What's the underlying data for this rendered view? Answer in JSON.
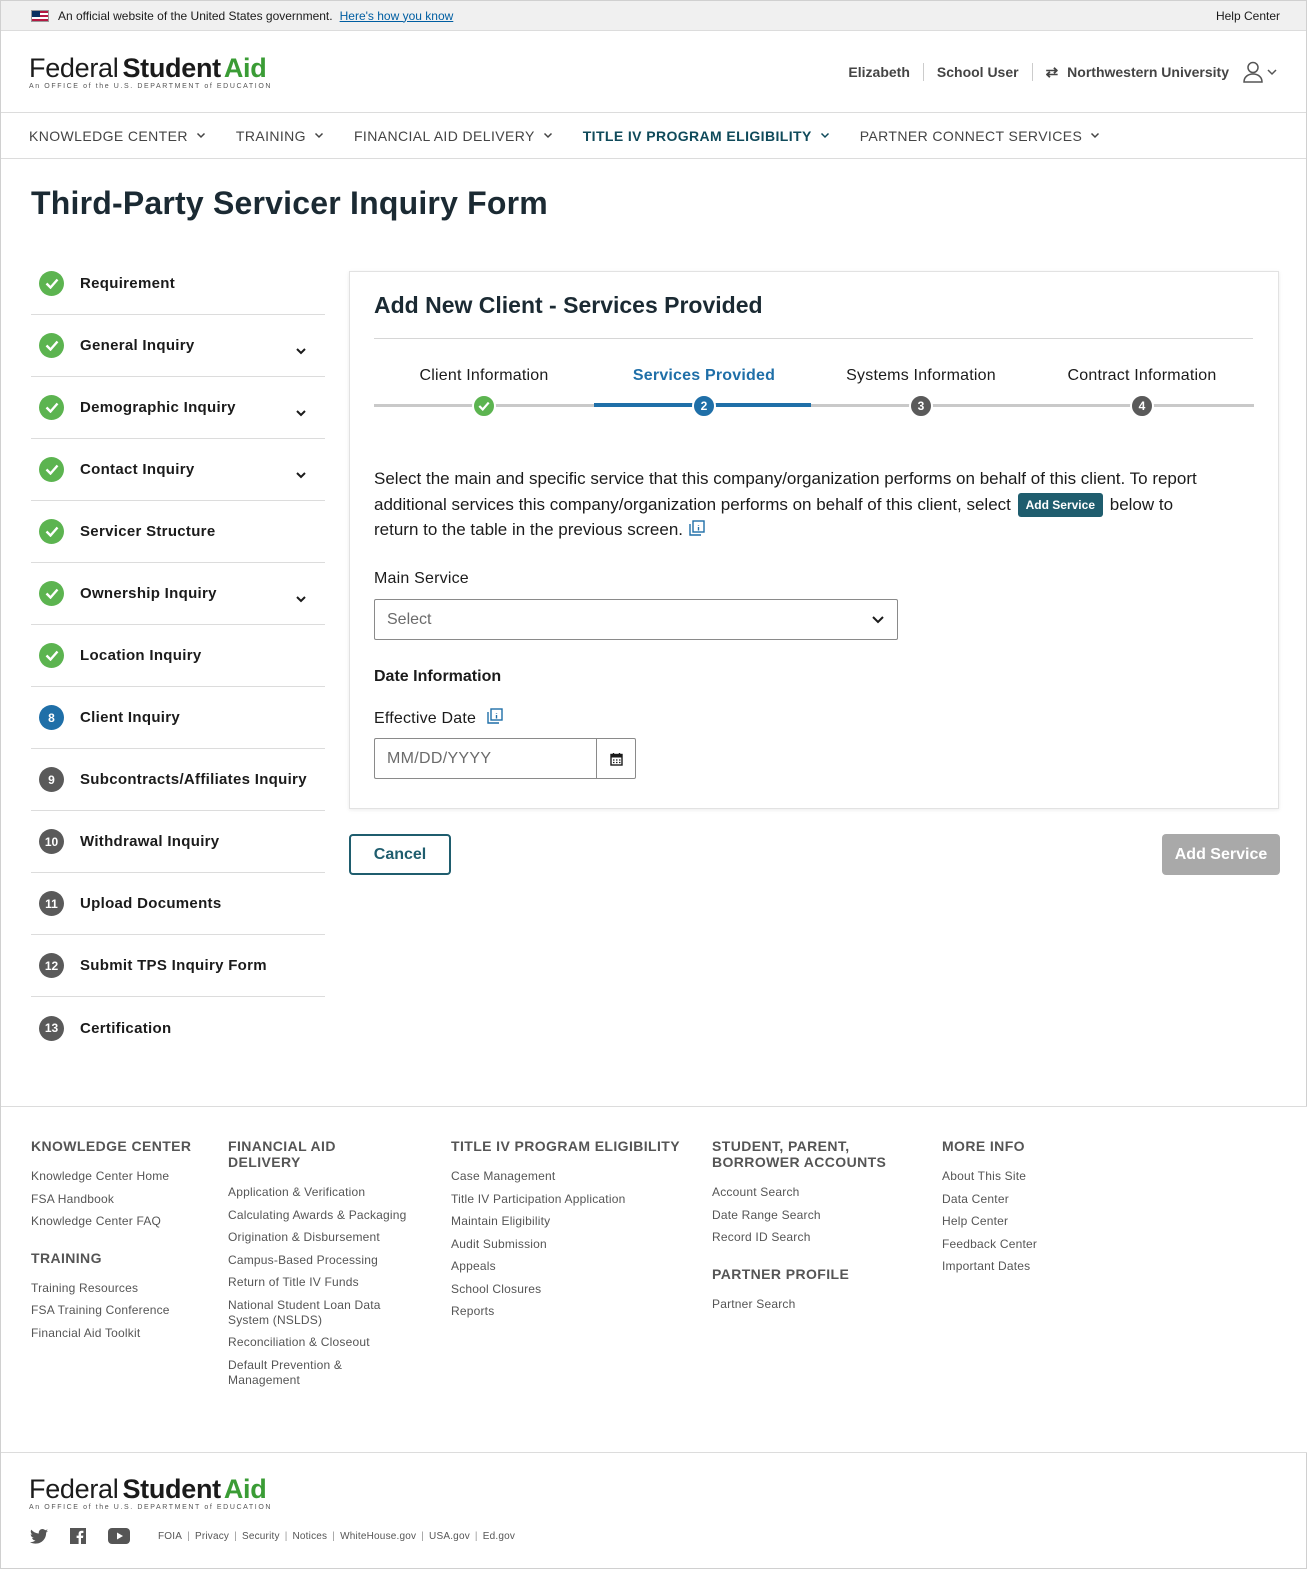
{
  "gov_banner": {
    "text": "An official website of the United States government.",
    "link": "Here's how you know",
    "help": "Help Center"
  },
  "logo": {
    "federal": "Federal",
    "student": "Student",
    "aid": "Aid",
    "sub": "An OFFICE of the U.S. DEPARTMENT of EDUCATION"
  },
  "user": {
    "name": "Elizabeth",
    "role": "School User",
    "org": "Northwestern University"
  },
  "nav": [
    {
      "label": "KNOWLEDGE CENTER"
    },
    {
      "label": "TRAINING"
    },
    {
      "label": "FINANCIAL AID DELIVERY"
    },
    {
      "label": "TITLE IV PROGRAM ELIGIBILITY",
      "active": true
    },
    {
      "label": "PARTNER CONNECT SERVICES"
    }
  ],
  "page_title": "Third-Party Servicer Inquiry Form",
  "steps": [
    {
      "badge": "",
      "label": "Requirement",
      "status": "done",
      "expandable": false
    },
    {
      "badge": "",
      "label": "General Inquiry",
      "status": "done",
      "expandable": true
    },
    {
      "badge": "",
      "label": "Demographic Inquiry",
      "status": "done",
      "expandable": true
    },
    {
      "badge": "",
      "label": "Contact Inquiry",
      "status": "done",
      "expandable": true
    },
    {
      "badge": "",
      "label": "Servicer Structure",
      "status": "done",
      "expandable": false
    },
    {
      "badge": "",
      "label": "Ownership Inquiry",
      "status": "done",
      "expandable": true
    },
    {
      "badge": "",
      "label": "Location Inquiry",
      "status": "done",
      "expandable": false
    },
    {
      "badge": "8",
      "label": "Client Inquiry",
      "status": "current",
      "expandable": false
    },
    {
      "badge": "9",
      "label": "Subcontracts/Affiliates Inquiry",
      "status": "todo",
      "expandable": false
    },
    {
      "badge": "10",
      "label": "Withdrawal Inquiry",
      "status": "todo",
      "expandable": false
    },
    {
      "badge": "11",
      "label": "Upload Documents",
      "status": "todo",
      "expandable": false
    },
    {
      "badge": "12",
      "label": "Submit TPS Inquiry Form",
      "status": "todo",
      "expandable": false
    },
    {
      "badge": "13",
      "label": "Certification",
      "status": "todo",
      "expandable": false
    }
  ],
  "card": {
    "title": "Add New Client - Services Provided",
    "progress": [
      {
        "label": "Client Information",
        "badge": "",
        "status": "done"
      },
      {
        "label": "Services Provided",
        "badge": "2",
        "status": "current"
      },
      {
        "label": "Systems Information",
        "badge": "3",
        "status": "todo"
      },
      {
        "label": "Contract Information",
        "badge": "4",
        "status": "todo"
      }
    ],
    "desc_part1": "Select the main and specific service that this company/organization performs on behalf of this client. To report additional services this company/organization performs on behalf of this client, select",
    "desc_button": "Add Service",
    "desc_part2": "below to return to the table in the previous screen.",
    "main_service_label": "Main Service",
    "main_service_value": "Select",
    "date_section": "Date Information",
    "effective_date_label": "Effective Date",
    "effective_date_placeholder": "MM/DD/YYYY"
  },
  "actions": {
    "cancel": "Cancel",
    "add": "Add Service"
  },
  "footer": {
    "col1": {
      "head": "KNOWLEDGE CENTER",
      "links": [
        "Knowledge Center Home",
        "FSA Handbook",
        "Knowledge Center FAQ"
      ],
      "head2": "TRAINING",
      "links2": [
        "Training Resources",
        "FSA Training Conference",
        "Financial Aid Toolkit"
      ]
    },
    "col2": {
      "head": "FINANCIAL AID DELIVERY",
      "links": [
        "Application & Verification",
        "Calculating Awards & Packaging",
        "Origination & Disbursement",
        "Campus-Based Processing",
        "Return of Title IV Funds",
        "National Student Loan Data System (NSLDS)",
        "Reconciliation & Closeout",
        "Default Prevention & Management"
      ]
    },
    "col3": {
      "head": "TITLE IV PROGRAM ELIGIBILITY",
      "links": [
        "Case Management",
        "Title IV Participation Application",
        "Maintain Eligibility",
        "Audit Submission",
        "Appeals",
        "School Closures",
        "Reports"
      ]
    },
    "col4": {
      "head": "STUDENT, PARENT, BORROWER ACCOUNTS",
      "links": [
        "Account Search",
        "Date Range Search",
        "Record ID Search"
      ],
      "head2": "PARTNER PROFILE",
      "links2": [
        "Partner Search"
      ]
    },
    "col5": {
      "head": "MORE INFO",
      "links": [
        "About This Site",
        "Data Center",
        "Help Center",
        "Feedback Center",
        "Important Dates"
      ]
    }
  },
  "legal": [
    "FOIA",
    "Privacy",
    "Security",
    "Notices",
    "WhiteHouse.gov",
    "USA.gov",
    "Ed.gov"
  ],
  "colors": {
    "brand_teal": "#1f5d6e",
    "active_blue": "#1f6fa8",
    "done_green": "#5cb450",
    "aid_green": "#3a9c35"
  }
}
